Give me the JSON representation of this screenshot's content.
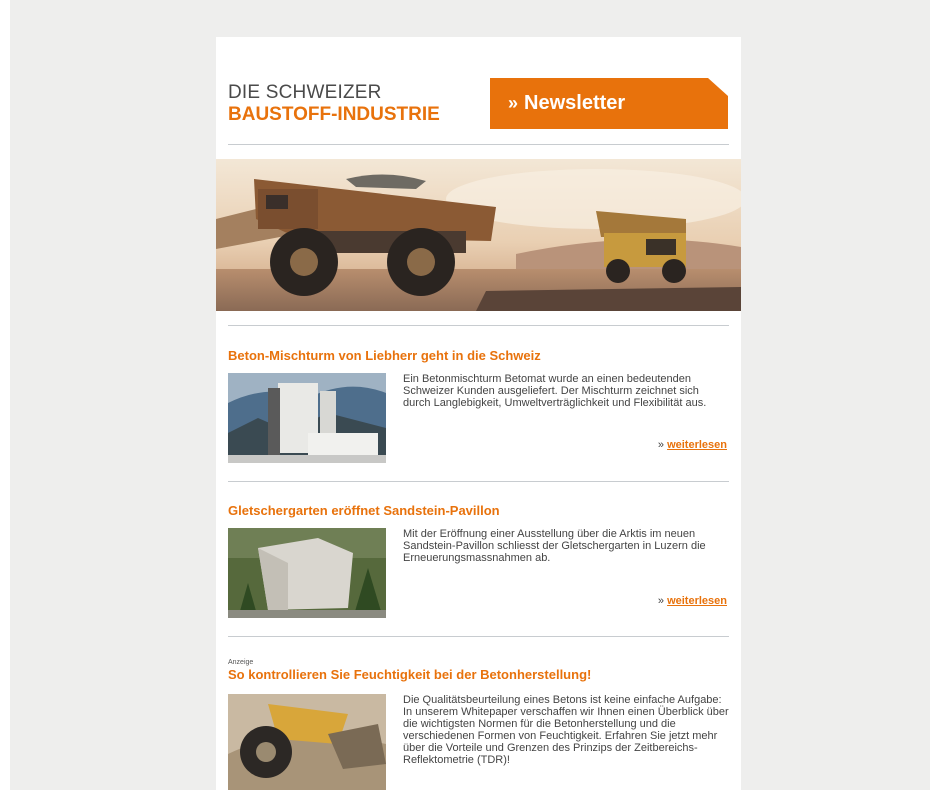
{
  "header": {
    "logo_line1": "DIE SCHWEIZER",
    "logo_line2": "BAUSTOFF-INDUSTRIE",
    "banner_chevron": "»",
    "banner_label": "Newsletter"
  },
  "colors": {
    "accent": "#e8720c",
    "backdrop": "#eeeeed",
    "rule": "#c8ccd0",
    "text": "#444444"
  },
  "articles": [
    {
      "headline": "Beton-Mischturm von Liebherr geht in die Schweiz",
      "body": "Ein Betonmischturm Betomat wurde an einen bedeutenden Schweizer Kunden ausgeliefert. Der Mischturm zeichnet sich durch Langlebigkeit, Umweltverträglichkeit und Flexibilität aus.",
      "more_prefix": "»",
      "more_label": "weiterlesen"
    },
    {
      "headline": "Gletschergarten eröffnet Sandstein-Pavillon",
      "body": "Mit der Eröffnung einer Ausstellung über die Arktis im neuen Sandstein-Pavillon schliesst der Gletschergarten in Luzern die Erneuerungsmassnahmen ab.",
      "more_prefix": "»",
      "more_label": "weiterlesen"
    },
    {
      "ad_label": "Anzeige",
      "headline": "So kontrollieren Sie Feuchtigkeit bei der Betonherstellung!",
      "body": "Die Qualitätsbeurteilung eines Betons ist keine einfache Aufgabe: In unserem Whitepaper verschaffen wir Ihnen einen Überblick über die wichtigsten Normen für die Betonherstellung und die verschiedenen Formen von Feuchtigkeit. Erfahren Sie jetzt mehr über die Vorteile und Grenzen des Prinzips der Zeitbereichs-Reflektometrie (TDR)!"
    }
  ]
}
